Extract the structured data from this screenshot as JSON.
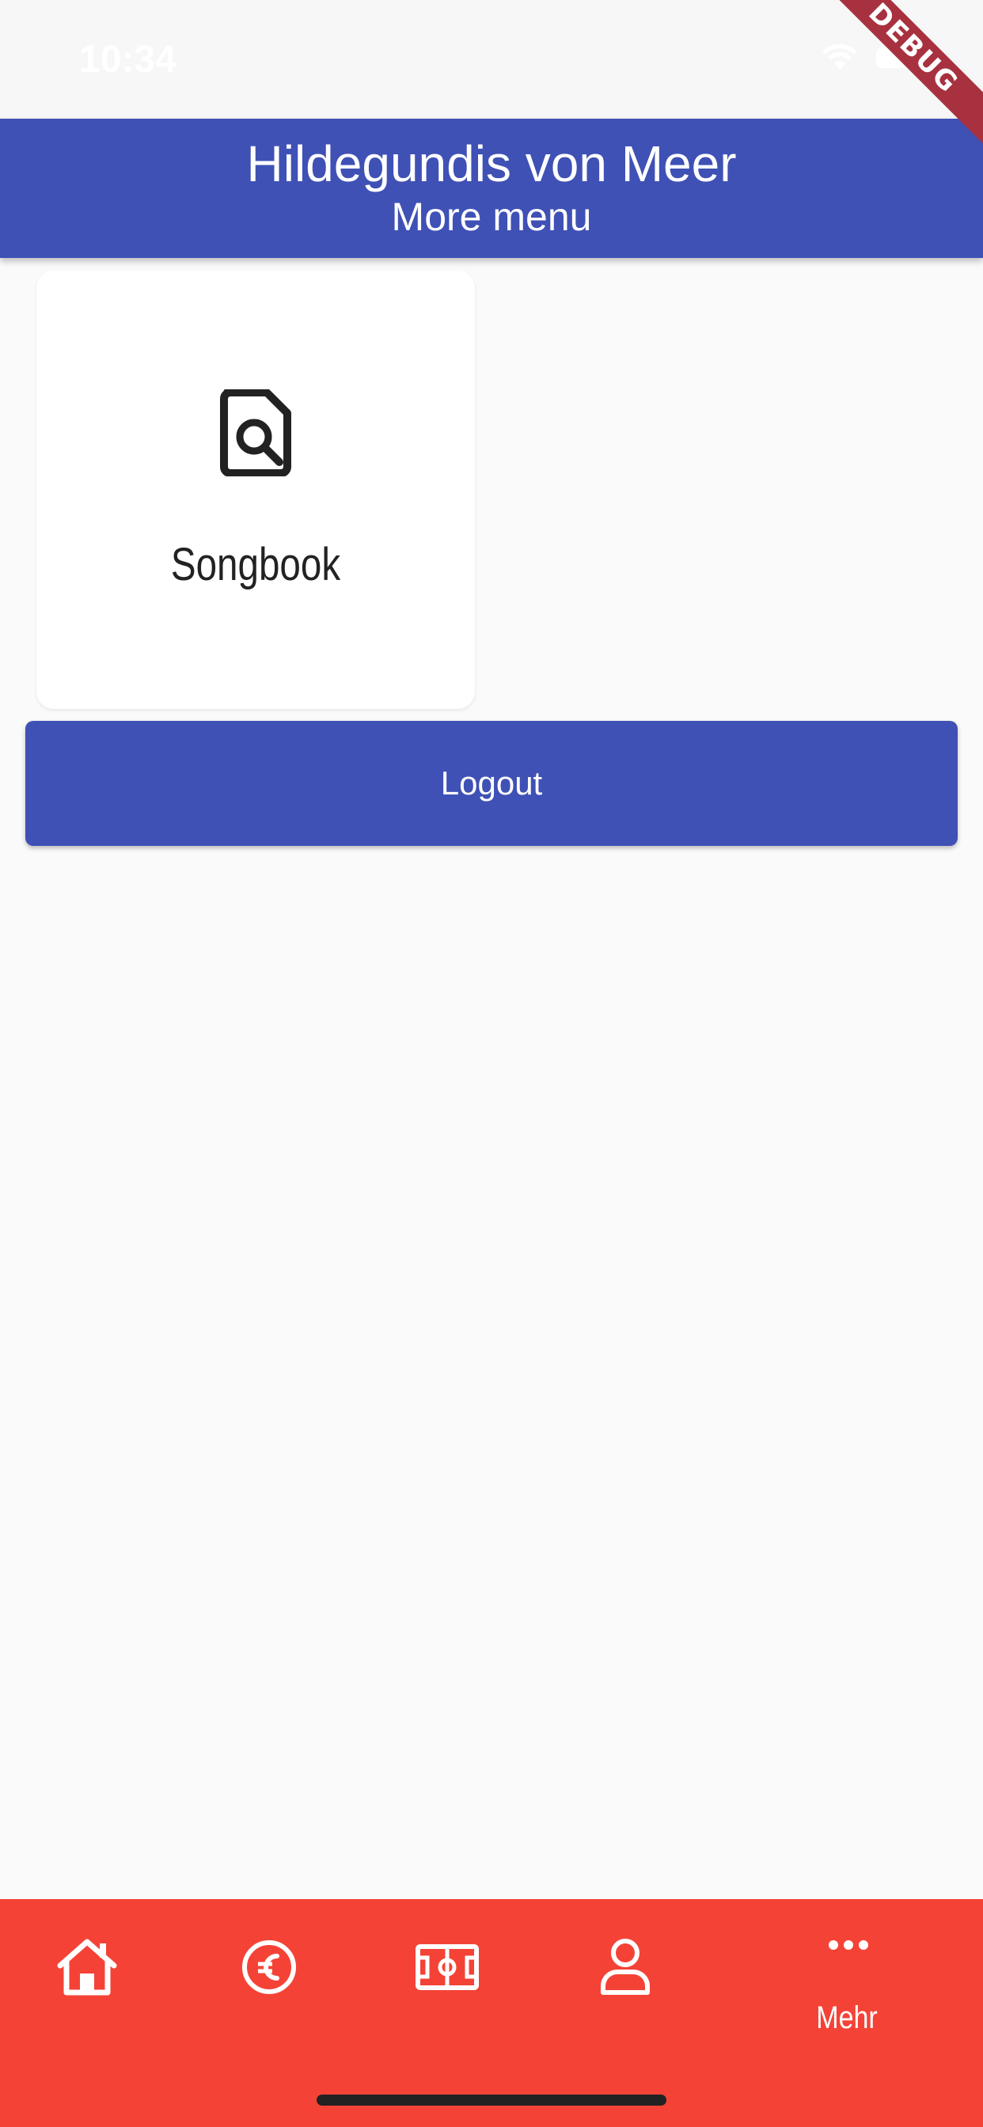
{
  "status_bar": {
    "time": "10:34"
  },
  "debug_banner": "DEBUG",
  "app_bar": {
    "title": "Hildegundis von Meer",
    "subtitle": "More menu"
  },
  "menu_tiles": [
    {
      "label": "Songbook",
      "icon": "document-search-icon"
    }
  ],
  "logout_label": "Logout",
  "bottom_nav": {
    "items": [
      {
        "id": "home",
        "icon": "home-icon",
        "label": ""
      },
      {
        "id": "finance",
        "icon": "euro-icon",
        "label": ""
      },
      {
        "id": "field",
        "icon": "soccer-field-icon",
        "label": ""
      },
      {
        "id": "profile",
        "icon": "person-icon",
        "label": ""
      },
      {
        "id": "more",
        "icon": "more-horizontal-icon",
        "label": "Mehr"
      }
    ]
  },
  "colors": {
    "app_bar": "#3f51b5",
    "bottom_nav": "#f44336",
    "background": "#fafafa",
    "debug_banner": "#a8313f"
  }
}
